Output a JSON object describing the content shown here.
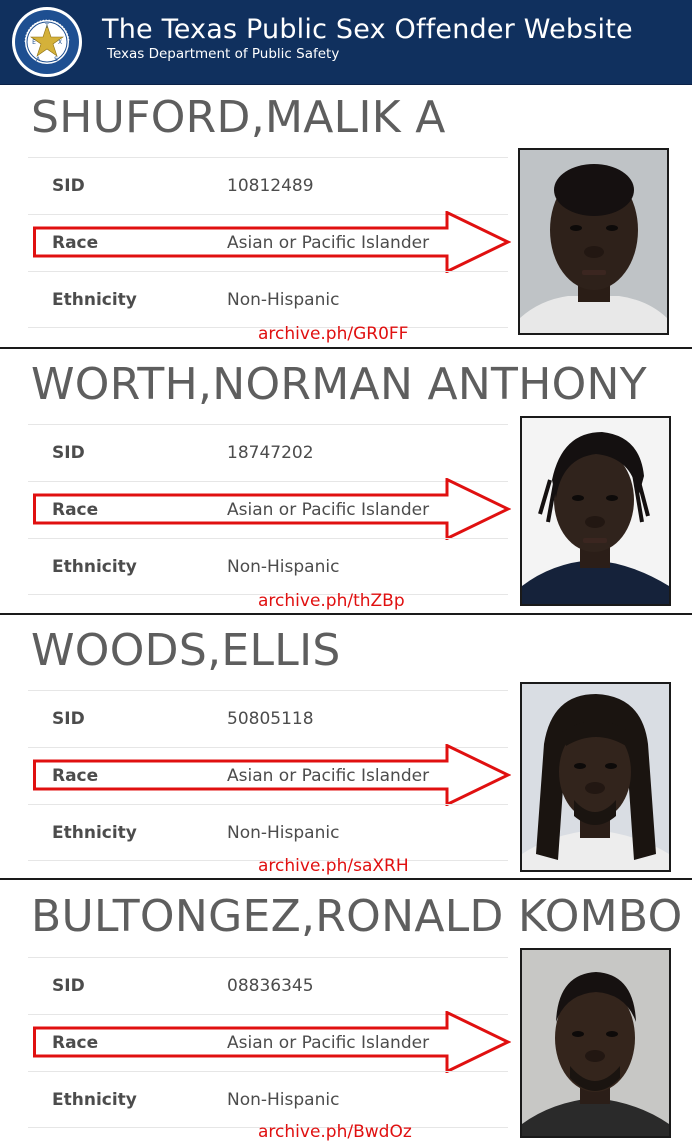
{
  "header": {
    "title": "The Texas Public Sex Offender Website",
    "subtitle": "Texas Department of Public Safety",
    "seal_letters": [
      "T",
      "E",
      "X",
      "A",
      "S"
    ],
    "colors": {
      "background": "#10305e",
      "text": "#ffffff",
      "seal_ring": "#1e4f91",
      "seal_star": "#d4b13a"
    }
  },
  "labels": {
    "sid": "SID",
    "race": "Race",
    "ethnicity": "Ethnicity"
  },
  "annotation_color": "#e01010",
  "offenders": [
    {
      "name": "SHUFORD,MALIK A",
      "sid": "10812489",
      "race": "Asian or Pacific Islander",
      "ethnicity": "Non-Hispanic",
      "archive": "archive.ph/GR0FF",
      "photo_icon": "mugshot-portrait"
    },
    {
      "name": "WORTH,NORMAN ANTHONY",
      "sid": "18747202",
      "race": "Asian or Pacific Islander",
      "ethnicity": "Non-Hispanic",
      "archive": "archive.ph/thZBp",
      "photo_icon": "mugshot-portrait"
    },
    {
      "name": "WOODS,ELLIS",
      "sid": "50805118",
      "race": "Asian or Pacific Islander",
      "ethnicity": "Non-Hispanic",
      "archive": "archive.ph/saXRH",
      "photo_icon": "mugshot-portrait"
    },
    {
      "name": "BULTONGEZ,RONALD KOMBO",
      "sid": "08836345",
      "race": "Asian or Pacific Islander",
      "ethnicity": "Non-Hispanic",
      "archive": "archive.ph/BwdOz",
      "photo_icon": "mugshot-portrait"
    }
  ]
}
